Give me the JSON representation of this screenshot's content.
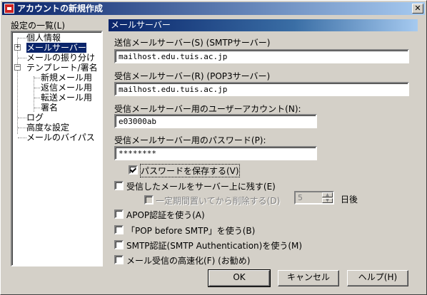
{
  "window": {
    "title": "アカウントの新規作成",
    "close_glyph": "✕"
  },
  "settings_label": "設定の一覧(L)",
  "tree": {
    "items": [
      {
        "label": "個人情報"
      },
      {
        "label": "メールサーバー",
        "selected": true,
        "expander": "+"
      },
      {
        "label": "メールの振り分け"
      },
      {
        "label": "テンプレート/署名",
        "expander": "−"
      },
      {
        "label": "新規メール用"
      },
      {
        "label": "返信メール用"
      },
      {
        "label": "転送メール用"
      },
      {
        "label": "署名"
      },
      {
        "label": "ログ"
      },
      {
        "label": "高度な設定"
      },
      {
        "label": "メールのバイパス"
      }
    ]
  },
  "panel": {
    "header": "メールサーバー",
    "smtp_label": "送信メールサーバー(S) (SMTPサーバー)",
    "smtp_value": "mailhost.edu.tuis.ac.jp",
    "pop3_label": "受信メールサーバー(R) (POP3サーバー)",
    "pop3_value": "mailhost.edu.tuis.ac.jp",
    "account_label": "受信メールサーバー用のユーザーアカウント(N):",
    "account_value": "e03000ab",
    "password_label": "受信メールサーバー用のパスワード(P):",
    "password_value": "********",
    "save_password": {
      "label": "パスワードを保存する(V)",
      "checked": true
    },
    "leave_on_server": {
      "label": "受信したメールをサーバー上に残す(E)",
      "checked": false
    },
    "delete_after": {
      "label": "一定期間置いてから削除する(D)",
      "checked": false,
      "disabled": true
    },
    "days_value": "5",
    "days_unit": "日後",
    "apop": {
      "label": "APOP認証を使う(A)",
      "checked": false
    },
    "pop_before_smtp": {
      "label": "「POP before SMTP」を使う(B)",
      "checked": false
    },
    "smtp_auth": {
      "label": "SMTP認証(SMTP Authentication)を使う(M)",
      "checked": false
    },
    "fast_receive": {
      "label": "メール受信の高速化(F) (お勧め)",
      "checked": false
    }
  },
  "buttons": {
    "ok": "OK",
    "cancel": "キャンセル",
    "help": "ヘルプ(H)"
  },
  "colors": {
    "titlebar": "#0a246a",
    "face": "#d4d0c8",
    "selection": "#0a246a"
  }
}
